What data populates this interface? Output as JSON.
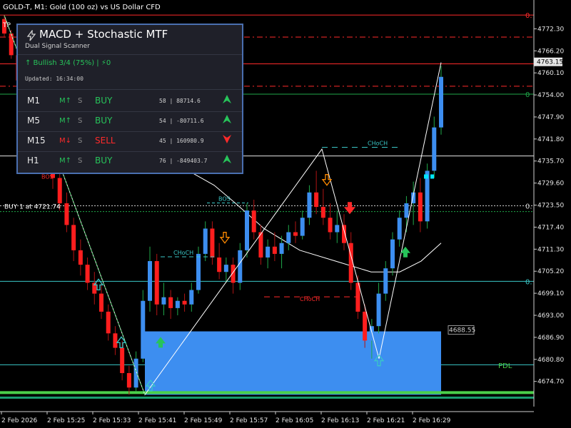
{
  "window": {
    "title": "GOLD-T, M1:  Gold (100 oz) vs US Dollar CFD"
  },
  "chart_data": {
    "type": "candlestick",
    "ylim": [
      4669.7,
      4778.3
    ],
    "y_ticks": [
      "4772.30",
      "4766.20",
      "4760.10",
      "4754.00",
      "4747.90",
      "4741.80",
      "4735.70",
      "4729.60",
      "4723.50",
      "4717.40",
      "4711.30",
      "4705.20",
      "4699.10",
      "4693.00",
      "4686.90",
      "4680.80",
      "4674.70"
    ],
    "x_ticks": [
      "2 Feb 2026",
      "2 Feb 15:25",
      "2 Feb 15:33",
      "2 Feb 15:41",
      "2 Feb 15:49",
      "2 Feb 15:57",
      "2 Feb 16:05",
      "2 Feb 16:13",
      "2 Feb 16:21",
      "2 Feb 16:29"
    ],
    "current_price": "4763.15",
    "box_price": "4688.55",
    "colors": {
      "bull": "#3d8ef0",
      "bear": "#ff1e1e",
      "hline_red": "#ff2a2a",
      "hline_green": "#1fa84a",
      "hline_white": "#e6e6e6",
      "hline_cyan": "#3ac7c7",
      "box": "#3d8ef0",
      "zigzag": "#ffffff",
      "ma": "#ffffff",
      "pdl": "#4ad04a"
    },
    "right_labels": [
      {
        "text": "0.",
        "color": "#ff2a2a",
        "price": 4776.1
      },
      {
        "text": "0",
        "color": "#1fa84a",
        "price": 4754.2
      },
      {
        "text": "0.",
        "color": "#cfcfcf",
        "price": 4723.3
      },
      {
        "text": "0.",
        "color": "#3ac7c7",
        "price": 4702.4
      }
    ],
    "annotations": [
      {
        "text": "BUY 1 at 4721.74",
        "color": "#ffffff"
      },
      {
        "text": "CHoCH",
        "color": "#3ac7c7",
        "price": 4739.5
      },
      {
        "text": "BOS",
        "color": "#3ac7c7",
        "price": 4724.1
      },
      {
        "text": "CHoCH",
        "color": "#3ac7c7",
        "price": 4709.2
      },
      {
        "text": "CHoCH",
        "color": "#ff2a2a",
        "price": 4698.1
      },
      {
        "text": "BOS",
        "color": "#ff2a2a",
        "price": 4731.4
      },
      {
        "text": "PDL",
        "color": "#4ad04a",
        "price": 4679.2
      }
    ],
    "candles": [
      [
        4775,
        4776,
        4770,
        4771
      ],
      [
        4771,
        4772,
        4764,
        4765
      ],
      [
        4765,
        4766,
        4757,
        4758
      ],
      [
        4758,
        4760,
        4752,
        4754
      ],
      [
        4754,
        4756,
        4744,
        4746
      ],
      [
        4746,
        4748,
        4738,
        4741
      ],
      [
        4741,
        4745,
        4733,
        4736
      ],
      [
        4736,
        4738,
        4728,
        4731
      ],
      [
        4731,
        4733,
        4722,
        4724
      ],
      [
        4724,
        4727,
        4716,
        4718
      ],
      [
        4718,
        4720,
        4708,
        4711
      ],
      [
        4711,
        4714,
        4704,
        4707
      ],
      [
        4707,
        4709,
        4700,
        4702
      ],
      [
        4702,
        4705,
        4696,
        4699
      ],
      [
        4699,
        4702,
        4692,
        4694
      ],
      [
        4694,
        4696,
        4686,
        4688
      ],
      [
        4688,
        4690,
        4682,
        4684
      ],
      [
        4684,
        4686,
        4675,
        4677
      ],
      [
        4677,
        4679,
        4671,
        4673
      ],
      [
        4673,
        4683,
        4672,
        4681
      ],
      [
        4681,
        4700,
        4680,
        4697
      ],
      [
        4697,
        4712,
        4694,
        4708
      ],
      [
        4708,
        4710,
        4693,
        4696
      ],
      [
        4696,
        4702,
        4693,
        4698
      ],
      [
        4698,
        4700,
        4692,
        4695
      ],
      [
        4695,
        4698,
        4693,
        4697
      ],
      [
        4697,
        4699,
        4694,
        4696
      ],
      [
        4696,
        4702,
        4694,
        4700
      ],
      [
        4700,
        4712,
        4699,
        4710
      ],
      [
        4710,
        4719,
        4708,
        4717
      ],
      [
        4717,
        4719,
        4707,
        4709
      ],
      [
        4709,
        4713,
        4703,
        4705
      ],
      [
        4705,
        4709,
        4702,
        4707
      ],
      [
        4707,
        4709,
        4699,
        4702
      ],
      [
        4702,
        4713,
        4700,
        4711
      ],
      [
        4711,
        4724,
        4709,
        4722
      ],
      [
        4722,
        4725,
        4714,
        4716
      ],
      [
        4716,
        4718,
        4707,
        4709
      ],
      [
        4709,
        4714,
        4706,
        4712
      ],
      [
        4712,
        4716,
        4708,
        4710
      ],
      [
        4710,
        4715,
        4706,
        4713
      ],
      [
        4713,
        4718,
        4711,
        4716
      ],
      [
        4716,
        4719,
        4713,
        4715
      ],
      [
        4715,
        4722,
        4714,
        4720
      ],
      [
        4720,
        4729,
        4718,
        4727
      ],
      [
        4727,
        4733,
        4721,
        4723
      ],
      [
        4723,
        4728,
        4718,
        4720
      ],
      [
        4720,
        4724,
        4714,
        4716
      ],
      [
        4716,
        4722,
        4713,
        4718
      ],
      [
        4718,
        4721,
        4711,
        4713
      ],
      [
        4713,
        4716,
        4700,
        4702
      ],
      [
        4702,
        4704,
        4692,
        4694
      ],
      [
        4694,
        4696,
        4684,
        4686
      ],
      [
        4686,
        4692,
        4681,
        4690
      ],
      [
        4690,
        4702,
        4688,
        4699
      ],
      [
        4699,
        4708,
        4697,
        4706
      ],
      [
        4706,
        4716,
        4704,
        4714
      ],
      [
        4714,
        4722,
        4712,
        4720
      ],
      [
        4720,
        4726,
        4716,
        4724
      ],
      [
        4724,
        4730,
        4718,
        4727
      ],
      [
        4727,
        4731,
        4716,
        4719
      ],
      [
        4719,
        4735,
        4717,
        4733
      ],
      [
        4733,
        4748,
        4731,
        4745
      ],
      [
        4745,
        4762,
        4743,
        4759
      ]
    ]
  },
  "panel": {
    "title": "MACD + Stochastic MTF",
    "subtitle": "Dual Signal Scanner",
    "bias": "↑ Bullish 3/4 (75%) | ⚡0",
    "updated": "Updated: 16:34:00",
    "rows": [
      {
        "tf": "M1",
        "macd": "M↑",
        "stoch": "S",
        "signal": "BUY",
        "values": "58 | 88714.6",
        "dir": "up"
      },
      {
        "tf": "M5",
        "macd": "M↑",
        "stoch": "S",
        "signal": "BUY",
        "values": "54 | -80711.6",
        "dir": "up"
      },
      {
        "tf": "M15",
        "macd": "M↓",
        "stoch": "S",
        "signal": "SELL",
        "values": "45 | 160980.9",
        "dir": "down"
      },
      {
        "tf": "H1",
        "macd": "M↑",
        "stoch": "S",
        "signal": "BUY",
        "values": "76 | -849403.7",
        "dir": "up"
      }
    ],
    "colors": {
      "buy": "#27c35a",
      "sell": "#ff2a2a",
      "border": "#4a6fb0",
      "bg": "#1f2029"
    }
  }
}
